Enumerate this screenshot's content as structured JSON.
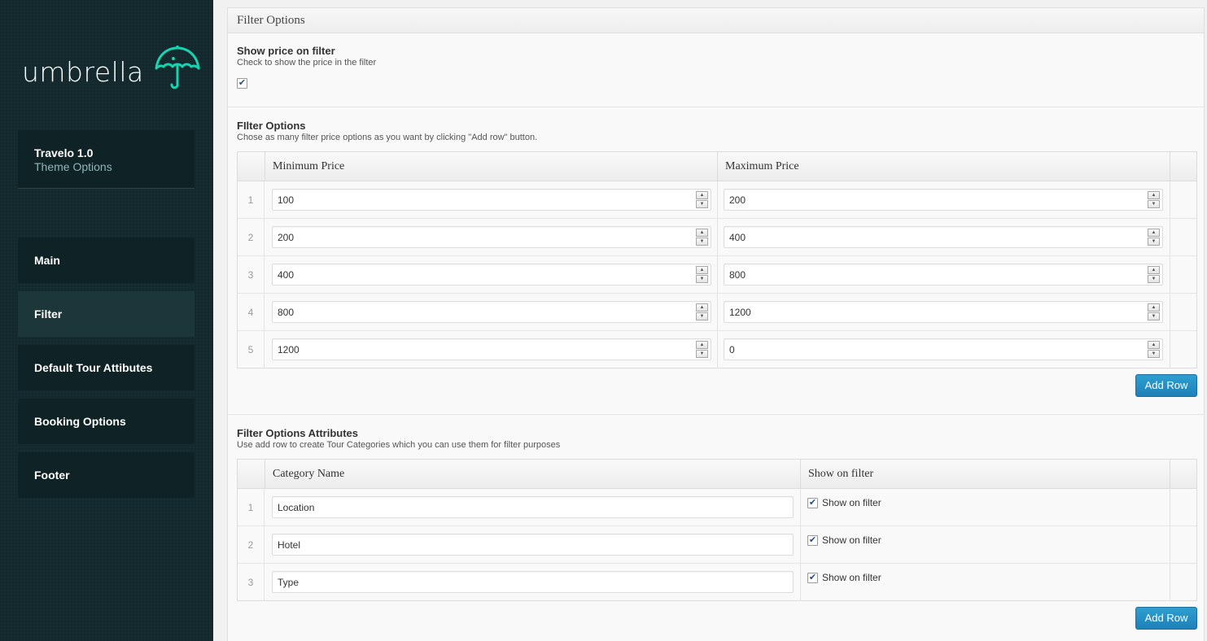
{
  "sidebar": {
    "logo_text": "umbrella",
    "theme_name": "Travelo 1.0",
    "theme_sub": "Theme Options",
    "items": [
      {
        "label": "Main",
        "active": false
      },
      {
        "label": "Filter",
        "active": true
      },
      {
        "label": "Default Tour Attibutes",
        "active": false
      },
      {
        "label": "Booking Options",
        "active": false
      },
      {
        "label": "Footer",
        "active": false
      }
    ],
    "colors": {
      "bg": "#13292d",
      "accent": "#19d3b0"
    }
  },
  "panel": {
    "title": "Filter Options",
    "show_price": {
      "title": "Show price on filter",
      "desc": "Check to show the price in the filter",
      "checked": true
    },
    "filter_options": {
      "title": "FIlter Options",
      "desc": "Chose as many filter price options as you want by clicking \"Add row\" button.",
      "col_min": "Minimum Price",
      "col_max": "Maximum Price",
      "rows": [
        {
          "num": "1",
          "min": "100",
          "max": "200"
        },
        {
          "num": "2",
          "min": "200",
          "max": "400"
        },
        {
          "num": "3",
          "min": "400",
          "max": "800"
        },
        {
          "num": "4",
          "min": "800",
          "max": "1200"
        },
        {
          "num": "5",
          "min": "1200",
          "max": "0"
        }
      ],
      "add_row_label": "Add Row"
    },
    "attributes": {
      "title": "Filter Options Attributes",
      "desc": "Use add row to create Tour Categories which you can use them for filter purposes",
      "col_name": "Category Name",
      "col_show": "Show on filter",
      "rows": [
        {
          "num": "1",
          "name": "Location",
          "show_label": "Show on filter",
          "checked": true
        },
        {
          "num": "2",
          "name": "Hotel",
          "show_label": "Show on filter",
          "checked": true
        },
        {
          "num": "3",
          "name": "Type",
          "show_label": "Show on filter",
          "checked": true
        }
      ],
      "add_row_label": "Add Row"
    }
  }
}
